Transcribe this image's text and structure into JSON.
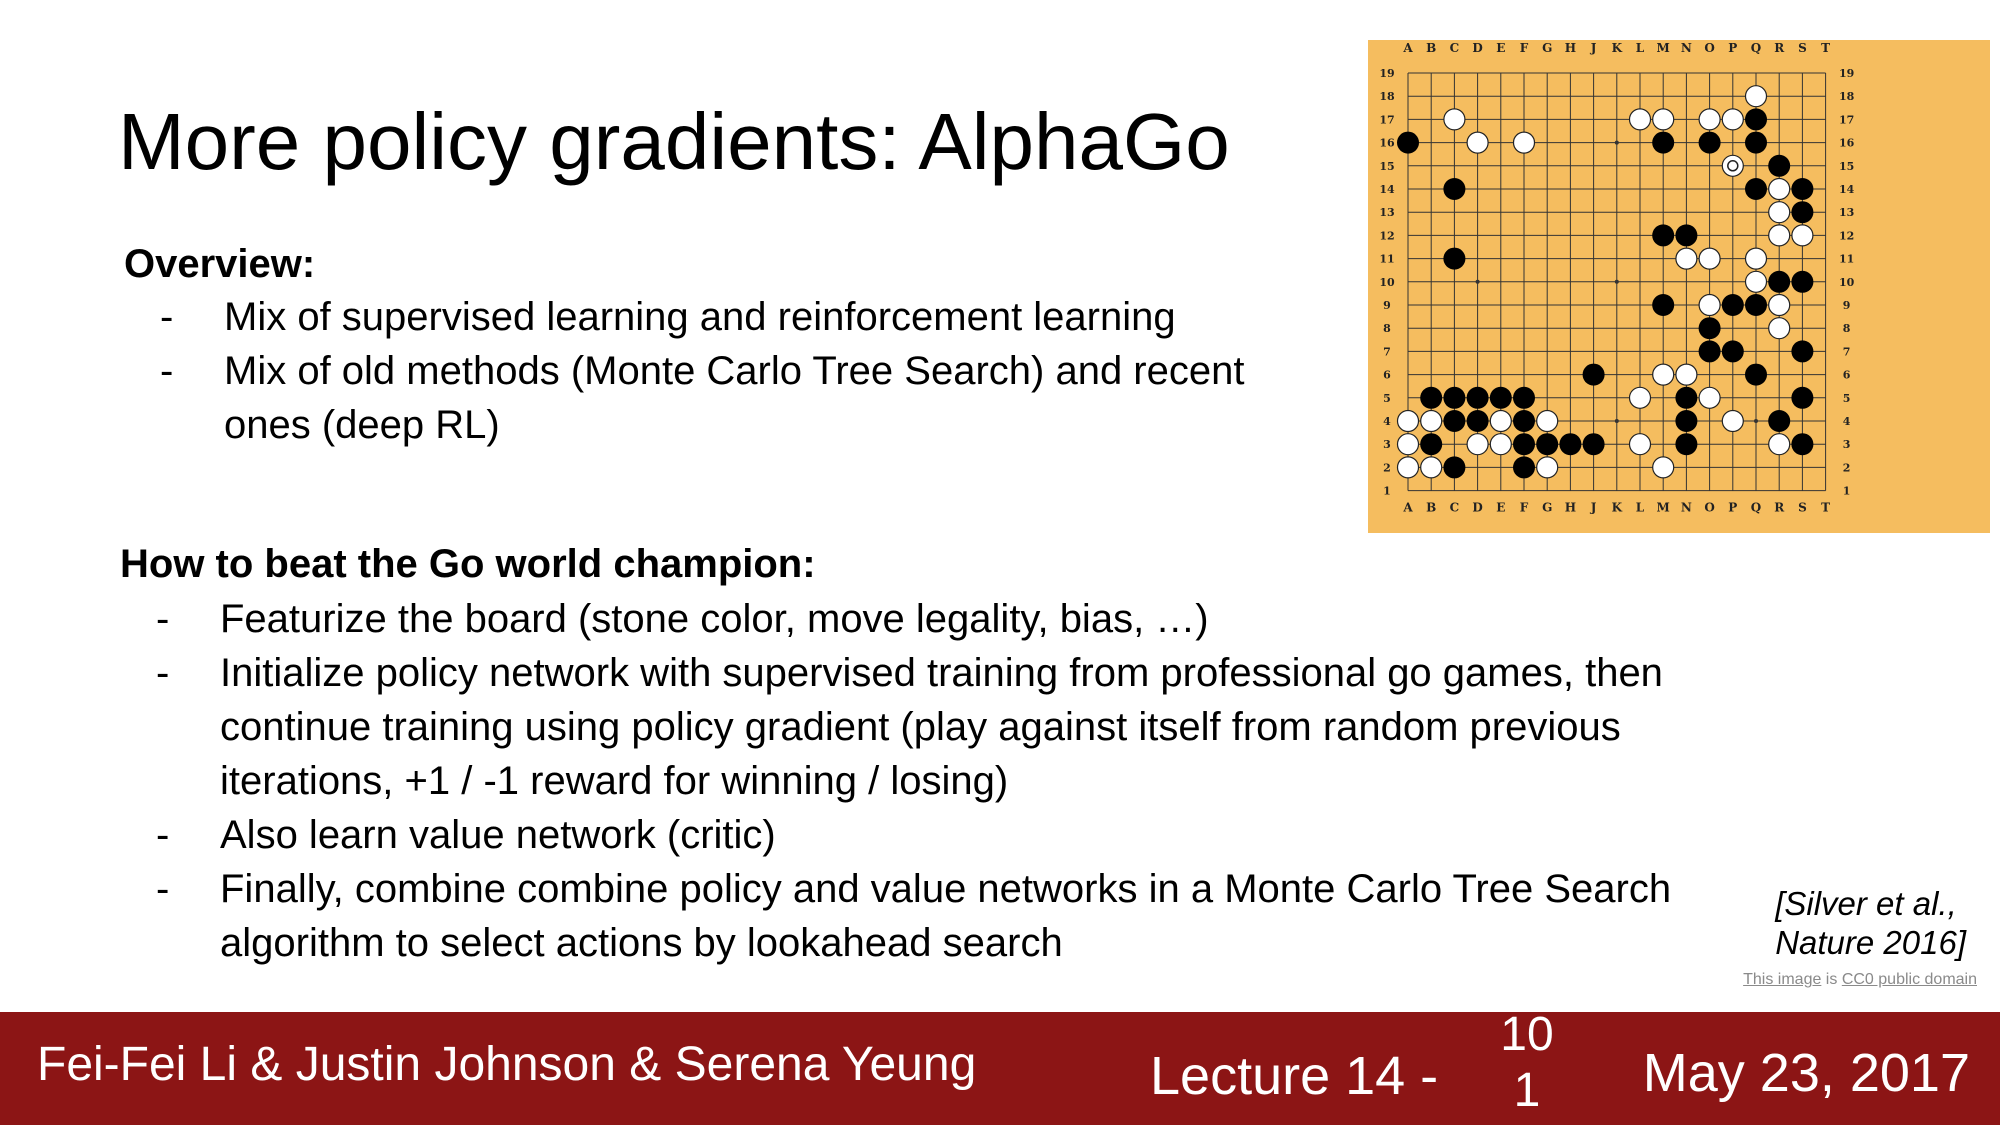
{
  "slide": {
    "title": "More policy gradients: AlphaGo"
  },
  "overview": {
    "heading": "Overview:",
    "items": [
      "Mix of supervised learning and reinforcement learning",
      "Mix of old methods (Monte Carlo Tree Search) and recent ones (deep RL)"
    ]
  },
  "beat": {
    "heading": "How to beat the Go world champion:",
    "items": [
      "Featurize the board (stone color, move legality, bias, …)",
      "Initialize policy network with supervised training from professional go games, then continue training using policy gradient (play against itself from random previous iterations, +1 / -1 reward for winning / losing)",
      "Also learn value network (critic)",
      "Finally, combine combine policy and value networks in a Monte Carlo Tree Search algorithm to select actions by lookahead search"
    ]
  },
  "bullet_dash": "-",
  "citation": {
    "line1": "[Silver et al.,",
    "line2": "Nature 2016]"
  },
  "image_credit": {
    "link1": "This image",
    "middle": " is ",
    "link2": "CC0 public domain"
  },
  "go_board": {
    "columns": [
      "A",
      "B",
      "C",
      "D",
      "E",
      "F",
      "G",
      "H",
      "J",
      "K",
      "L",
      "M",
      "N",
      "O",
      "P",
      "Q",
      "R",
      "S",
      "T"
    ],
    "rows": [
      "19",
      "18",
      "17",
      "16",
      "15",
      "14",
      "13",
      "12",
      "11",
      "10",
      "9",
      "8",
      "7",
      "6",
      "5",
      "4",
      "3",
      "2",
      "1"
    ],
    "board_color": "#f5bd5f",
    "black_stones": [
      "Q17",
      "A16",
      "M16",
      "O16",
      "Q16",
      "R15",
      "C14",
      "Q14",
      "S14",
      "S13",
      "M12",
      "N12",
      "C11",
      "R10",
      "S10",
      "M9",
      "P9",
      "Q9",
      "O8",
      "O7",
      "P7",
      "S7",
      "J6",
      "Q6",
      "B5",
      "C5",
      "D5",
      "E5",
      "F5",
      "N5",
      "S5",
      "C4",
      "D4",
      "F4",
      "N4",
      "R4",
      "B3",
      "F3",
      "G3",
      "H3",
      "J3",
      "N3",
      "S3",
      "C2",
      "F2"
    ],
    "white_stones": [
      "Q18",
      "C17",
      "L17",
      "M17",
      "O17",
      "P17",
      "D16",
      "F16",
      "R14",
      "R13",
      "R12",
      "S12",
      "N11",
      "O11",
      "Q11",
      "Q10",
      "O9",
      "R9",
      "R8",
      "M6",
      "N6",
      "L5",
      "O5",
      "A4",
      "B4",
      "E4",
      "G4",
      "P4",
      "A3",
      "D3",
      "E3",
      "L3",
      "R3",
      "A2",
      "B2",
      "G2",
      "M2"
    ],
    "marked_stones": [
      "P15"
    ],
    "star_points": [
      "D16",
      "K16",
      "Q16",
      "D10",
      "K10",
      "Q10",
      "D4",
      "K4",
      "Q4"
    ]
  },
  "footer": {
    "authors": "Fei-Fei Li & Justin Johnson & Serena Yeung",
    "lecture": "Lecture 14 -",
    "page": "101",
    "date": "May 23, 2017",
    "background_color": "#8c1515"
  }
}
